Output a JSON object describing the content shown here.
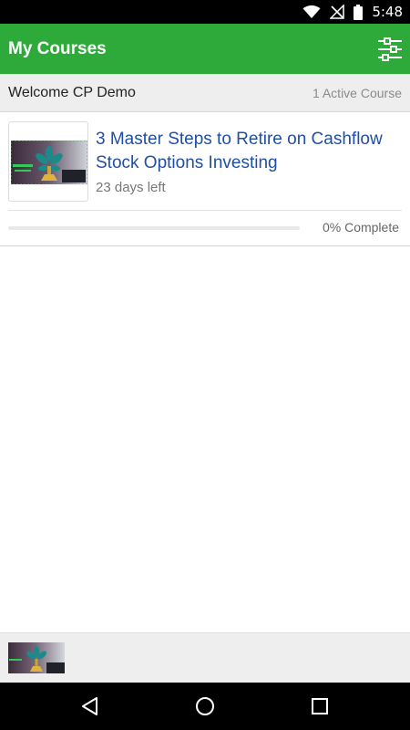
{
  "status_bar": {
    "time": "5:48",
    "icons": [
      "wifi-icon",
      "no-signal-icon",
      "battery-icon"
    ]
  },
  "app_bar": {
    "title": "My Courses",
    "filter_icon": "sliders-icon"
  },
  "welcome": {
    "greeting": "Welcome CP Demo",
    "active_count": "1 Active Course"
  },
  "courses": [
    {
      "title": "3 Master Steps to Retire on Cashflow Stock Options Investing",
      "days_left": "23 days left",
      "progress_label": "0% Complete",
      "progress_fraction": 0
    }
  ],
  "nav_bar": {
    "icons": [
      "back-icon",
      "home-icon",
      "recents-icon"
    ]
  },
  "colors": {
    "brand_green": "#2eaa3a",
    "link_blue": "#1f4fa6",
    "welcome_bg": "#eeeeee"
  }
}
